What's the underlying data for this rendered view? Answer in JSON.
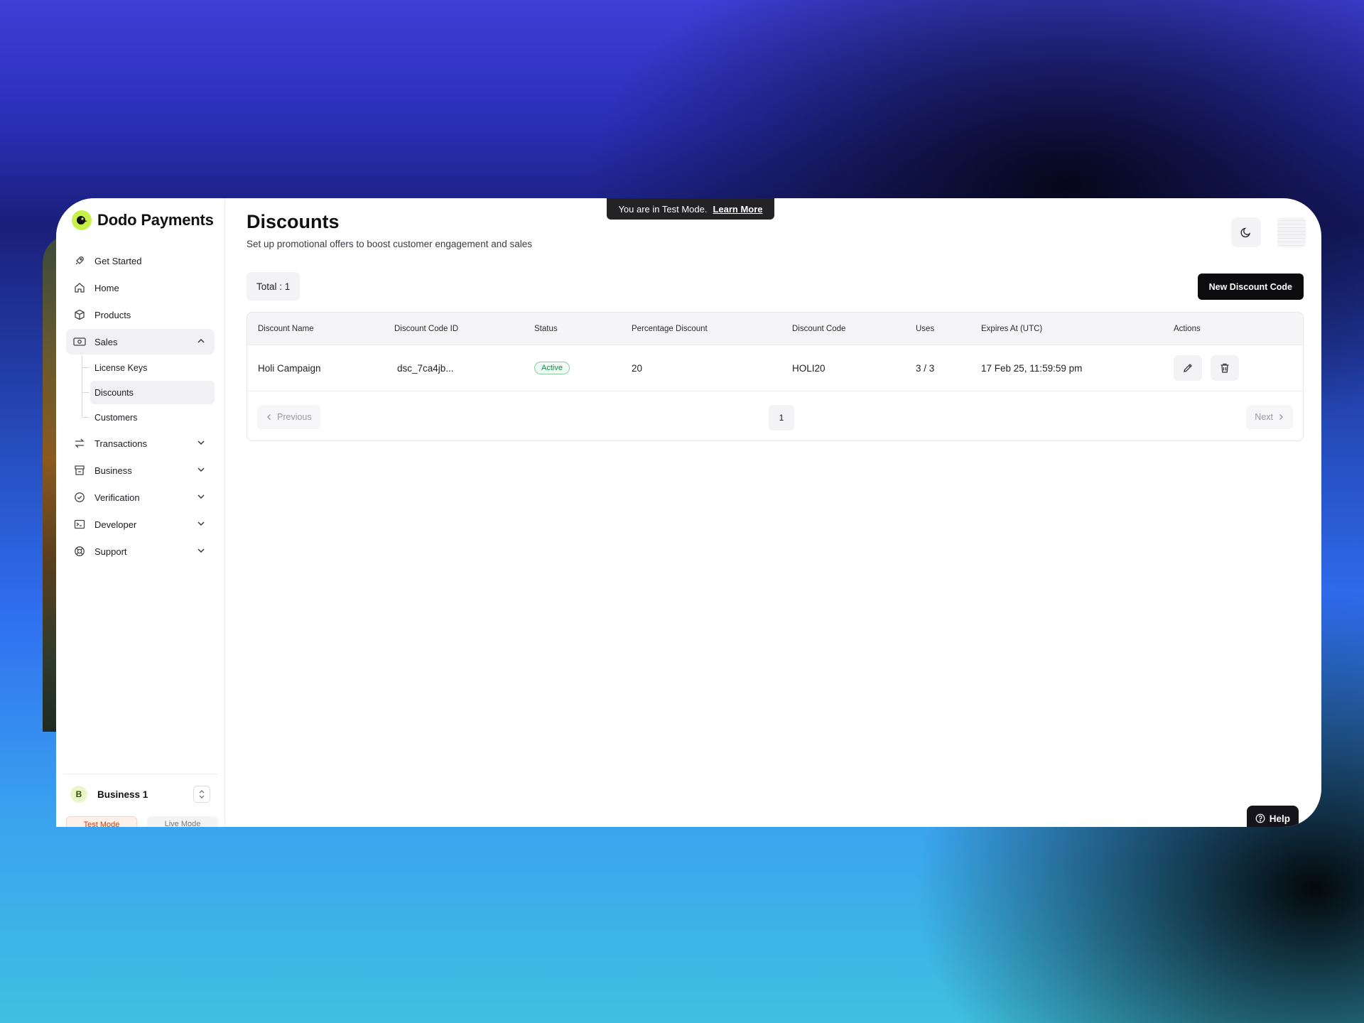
{
  "app": {
    "name": "Dodo Payments"
  },
  "banner": {
    "text": "You are in Test Mode.",
    "link": "Learn More"
  },
  "sidebar": {
    "items": [
      {
        "label": "Get Started",
        "icon": "rocket-icon"
      },
      {
        "label": "Home",
        "icon": "home-icon"
      },
      {
        "label": "Products",
        "icon": "box-icon"
      },
      {
        "label": "Sales",
        "icon": "cash-icon",
        "expanded": true
      },
      {
        "label": "Transactions",
        "icon": "arrows-icon"
      },
      {
        "label": "Business",
        "icon": "store-icon"
      },
      {
        "label": "Verification",
        "icon": "badge-check-icon"
      },
      {
        "label": "Developer",
        "icon": "terminal-icon"
      },
      {
        "label": "Support",
        "icon": "lifebuoy-icon"
      }
    ],
    "sales_sub": [
      {
        "label": "License Keys"
      },
      {
        "label": "Discounts",
        "active": true
      },
      {
        "label": "Customers"
      }
    ],
    "business": {
      "initial": "B",
      "name": "Business 1"
    },
    "modes": {
      "test": "Test Mode",
      "live": "Live Mode"
    }
  },
  "page": {
    "title": "Discounts",
    "subtitle": "Set up promotional offers to boost customer engagement and sales",
    "total": "Total : 1",
    "new_button": "New Discount Code"
  },
  "table": {
    "headers": [
      "Discount Name",
      "Discount Code ID",
      "Status",
      "Percentage Discount",
      "Discount Code",
      "Uses",
      "Expires At (UTC)",
      "Actions"
    ],
    "rows": [
      {
        "name": "Holi Campaign",
        "code_id": "dsc_7ca4jb...",
        "status": "Active",
        "percentage": "20",
        "code": "HOLI20",
        "uses": "3 / 3",
        "expires": "17 Feb 25, 11:59:59 pm"
      }
    ]
  },
  "pagination": {
    "previous": "Previous",
    "current": "1",
    "next": "Next"
  },
  "help": {
    "label": "Help"
  },
  "colors": {
    "brand": "#c8f04a",
    "active_status": "#1a8a4a",
    "primary_button": "#0c0c0e"
  }
}
